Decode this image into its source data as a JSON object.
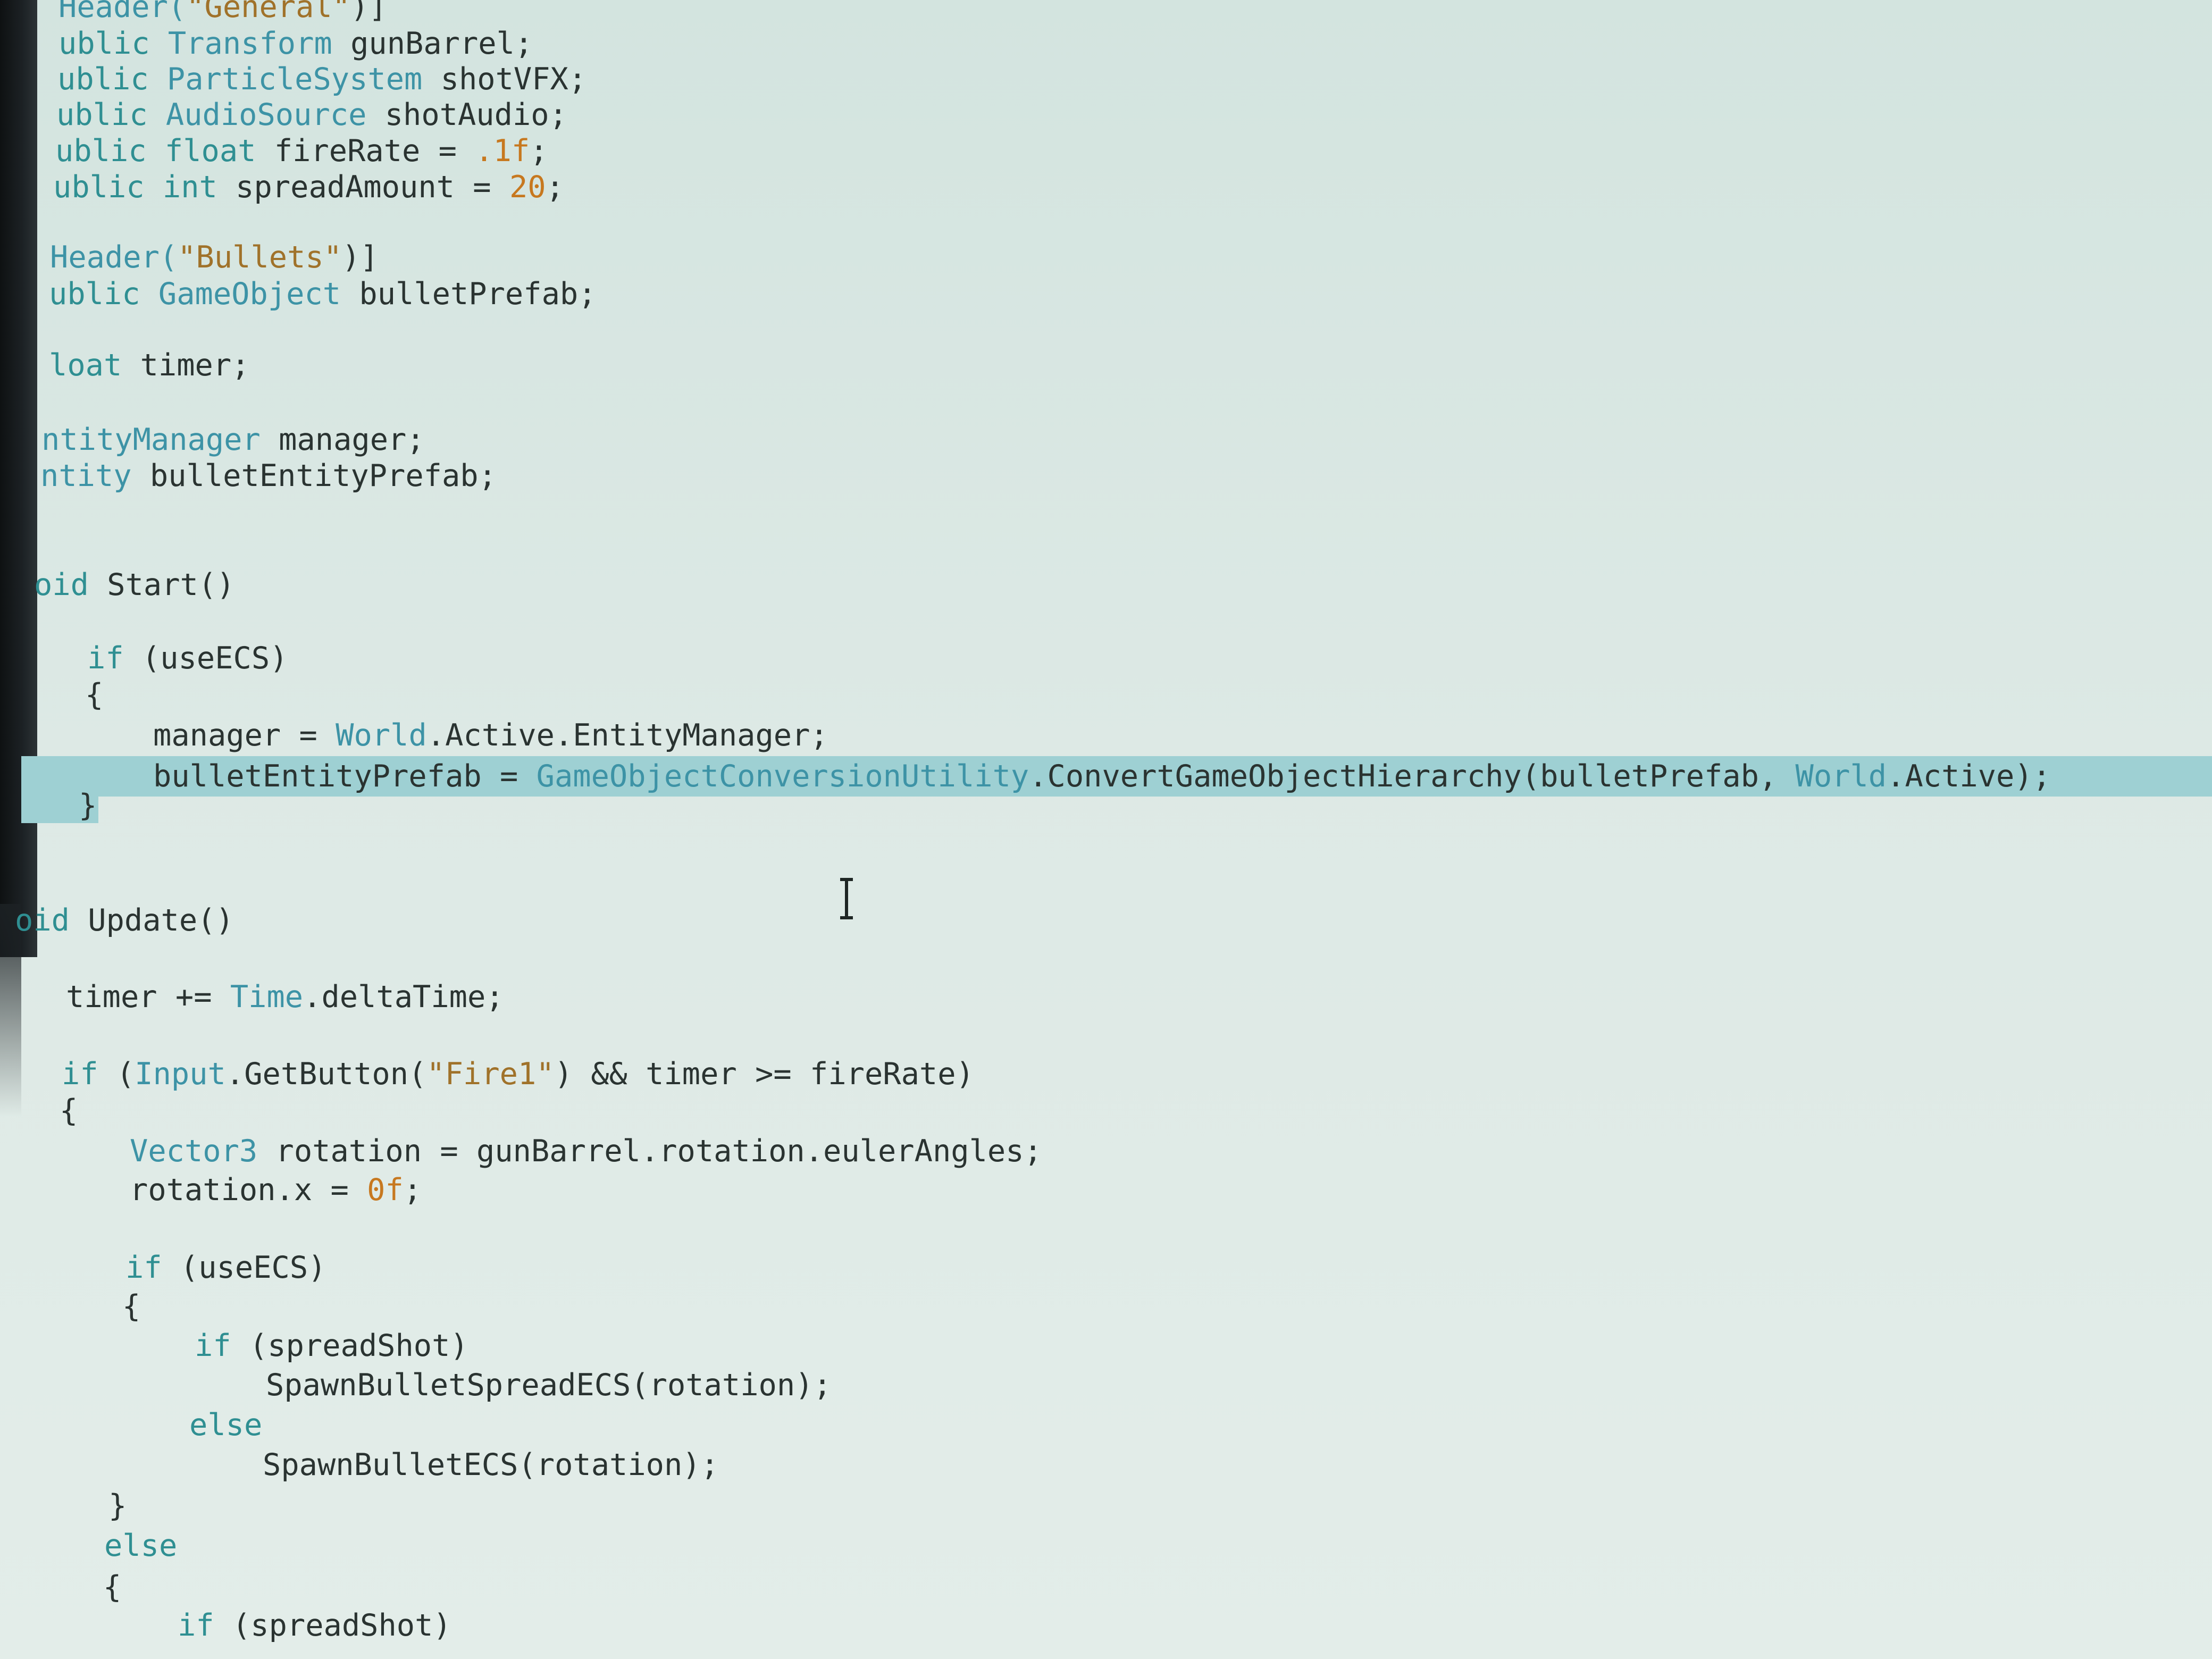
{
  "editor": {
    "lines": [
      {
        "segs": [
          {
            "t": "Header(",
            "c": "ty"
          },
          {
            "t": "\"General\"",
            "c": "st"
          },
          {
            "t": ")]",
            "c": "pl"
          }
        ]
      },
      {
        "segs": [
          {
            "t": "ublic ",
            "c": "kw"
          },
          {
            "t": "Transform",
            "c": "ty"
          },
          {
            "t": " gunBarrel;",
            "c": "pl"
          }
        ]
      },
      {
        "segs": [
          {
            "t": "ublic ",
            "c": "kw"
          },
          {
            "t": "ParticleSystem",
            "c": "ty"
          },
          {
            "t": " shotVFX;",
            "c": "pl"
          }
        ]
      },
      {
        "segs": [
          {
            "t": "ublic ",
            "c": "kw"
          },
          {
            "t": "AudioSource",
            "c": "ty"
          },
          {
            "t": " shotAudio;",
            "c": "pl"
          }
        ]
      },
      {
        "segs": [
          {
            "t": "ublic ",
            "c": "kw"
          },
          {
            "t": "float",
            "c": "kw"
          },
          {
            "t": " fireRate = ",
            "c": "pl"
          },
          {
            "t": ".1f",
            "c": "nu"
          },
          {
            "t": ";",
            "c": "pl"
          }
        ]
      },
      {
        "segs": [
          {
            "t": "ublic ",
            "c": "kw"
          },
          {
            "t": "int",
            "c": "kw"
          },
          {
            "t": " spreadAmount = ",
            "c": "pl"
          },
          {
            "t": "20",
            "c": "nu"
          },
          {
            "t": ";",
            "c": "pl"
          }
        ]
      },
      {
        "segs": [
          {
            "t": "Header(",
            "c": "ty"
          },
          {
            "t": "\"Bullets\"",
            "c": "st"
          },
          {
            "t": ")]",
            "c": "pl"
          }
        ]
      },
      {
        "segs": [
          {
            "t": "ublic ",
            "c": "kw"
          },
          {
            "t": "GameObject",
            "c": "ty"
          },
          {
            "t": " bulletPrefab;",
            "c": "pl"
          }
        ]
      },
      {
        "segs": [
          {
            "t": "loat",
            "c": "kw"
          },
          {
            "t": " timer;",
            "c": "pl"
          }
        ]
      },
      {
        "segs": [
          {
            "t": "ntityManager",
            "c": "ty"
          },
          {
            "t": " manager;",
            "c": "pl"
          }
        ]
      },
      {
        "segs": [
          {
            "t": "ntity",
            "c": "ty"
          },
          {
            "t": " bulletEntityPrefab;",
            "c": "pl"
          }
        ]
      },
      {
        "segs": [
          {
            "t": "oid",
            "c": "kw"
          },
          {
            "t": " Start()",
            "c": "pl"
          }
        ]
      },
      {
        "segs": [
          {
            "t": "if",
            "c": "kw"
          },
          {
            "t": " (useECS)",
            "c": "pl"
          }
        ]
      },
      {
        "segs": [
          {
            "t": "{",
            "c": "pl"
          }
        ]
      },
      {
        "segs": [
          {
            "t": "manager = ",
            "c": "pl"
          },
          {
            "t": "World",
            "c": "ty"
          },
          {
            "t": ".Active.EntityManager;",
            "c": "pl"
          }
        ]
      },
      {
        "segs": [
          {
            "t": "bulletEntityPrefab = ",
            "c": "pl"
          },
          {
            "t": "GameObjectConversionUtility",
            "c": "ty"
          },
          {
            "t": ".ConvertGameObjectHierarchy(bulletPrefab, ",
            "c": "pl"
          },
          {
            "t": "World",
            "c": "ty"
          },
          {
            "t": ".Active);",
            "c": "pl"
          }
        ]
      },
      {
        "segs": [
          {
            "t": "}",
            "c": "pl"
          }
        ]
      },
      {
        "segs": [
          {
            "t": "oid",
            "c": "kw"
          },
          {
            "t": " Update()",
            "c": "pl"
          }
        ]
      },
      {
        "segs": [
          {
            "t": "timer += ",
            "c": "pl"
          },
          {
            "t": "Time",
            "c": "ty"
          },
          {
            "t": ".deltaTime;",
            "c": "pl"
          }
        ]
      },
      {
        "segs": [
          {
            "t": "if",
            "c": "kw"
          },
          {
            "t": " (",
            "c": "pl"
          },
          {
            "t": "Input",
            "c": "ty"
          },
          {
            "t": ".GetButton(",
            "c": "pl"
          },
          {
            "t": "\"Fire1\"",
            "c": "st"
          },
          {
            "t": ") && timer >= fireRate)",
            "c": "pl"
          }
        ]
      },
      {
        "segs": [
          {
            "t": "{",
            "c": "pl"
          }
        ]
      },
      {
        "segs": [
          {
            "t": "Vector3",
            "c": "ty"
          },
          {
            "t": " rotation = gunBarrel.rotation.eulerAngles;",
            "c": "pl"
          }
        ]
      },
      {
        "segs": [
          {
            "t": "rotation.x = ",
            "c": "pl"
          },
          {
            "t": "0f",
            "c": "nu"
          },
          {
            "t": ";",
            "c": "pl"
          }
        ]
      },
      {
        "segs": [
          {
            "t": "if",
            "c": "kw"
          },
          {
            "t": " (useECS)",
            "c": "pl"
          }
        ]
      },
      {
        "segs": [
          {
            "t": "{",
            "c": "pl"
          }
        ]
      },
      {
        "segs": [
          {
            "t": "if",
            "c": "kw"
          },
          {
            "t": " (spreadShot)",
            "c": "pl"
          }
        ]
      },
      {
        "segs": [
          {
            "t": "SpawnBulletSpreadECS(rotation);",
            "c": "pl"
          }
        ]
      },
      {
        "segs": [
          {
            "t": "else",
            "c": "kw"
          }
        ]
      },
      {
        "segs": [
          {
            "t": "SpawnBulletECS(rotation);",
            "c": "pl"
          }
        ]
      },
      {
        "segs": [
          {
            "t": "}",
            "c": "pl"
          }
        ]
      },
      {
        "segs": [
          {
            "t": "else",
            "c": "kw"
          }
        ]
      },
      {
        "segs": [
          {
            "t": "{",
            "c": "pl"
          }
        ]
      },
      {
        "segs": [
          {
            "t": "if",
            "c": "kw"
          },
          {
            "t": " (spreadShot)",
            "c": "pl"
          }
        ]
      }
    ]
  }
}
